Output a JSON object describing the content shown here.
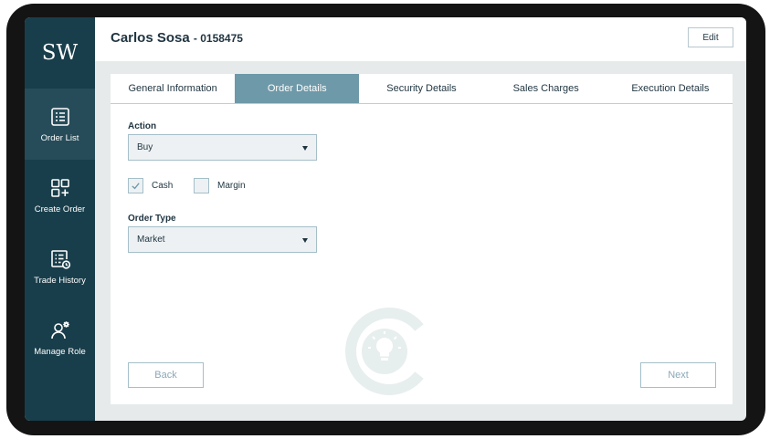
{
  "sidebar": {
    "logo": "SW",
    "items": [
      {
        "label": "Order List",
        "icon": "list-icon",
        "active": true
      },
      {
        "label": "Create Order",
        "icon": "grid-plus-icon",
        "active": false
      },
      {
        "label": "Trade History",
        "icon": "history-icon",
        "active": false
      },
      {
        "label": "Manage Role",
        "icon": "user-gear-icon",
        "active": false
      }
    ]
  },
  "header": {
    "client_name": "Carlos Sosa",
    "client_id": "- 0158475",
    "edit_label": "Edit"
  },
  "tabs": [
    {
      "label": "General Information",
      "active": false
    },
    {
      "label": "Order Details",
      "active": true
    },
    {
      "label": "Security Details",
      "active": false
    },
    {
      "label": "Sales Charges",
      "active": false
    },
    {
      "label": "Execution Details",
      "active": false
    }
  ],
  "form": {
    "action_label": "Action",
    "action_value": "Buy",
    "cash_label": "Cash",
    "cash_checked": true,
    "margin_label": "Margin",
    "margin_checked": false,
    "order_type_label": "Order Type",
    "order_type_value": "Market"
  },
  "footer": {
    "back_label": "Back",
    "next_label": "Next"
  },
  "colors": {
    "sidebar": "#193e4b",
    "sidebar_active": "#264c59",
    "tab_active": "#6e99a8",
    "field_bg": "#edf1f3",
    "border": "#a5bfc9"
  }
}
